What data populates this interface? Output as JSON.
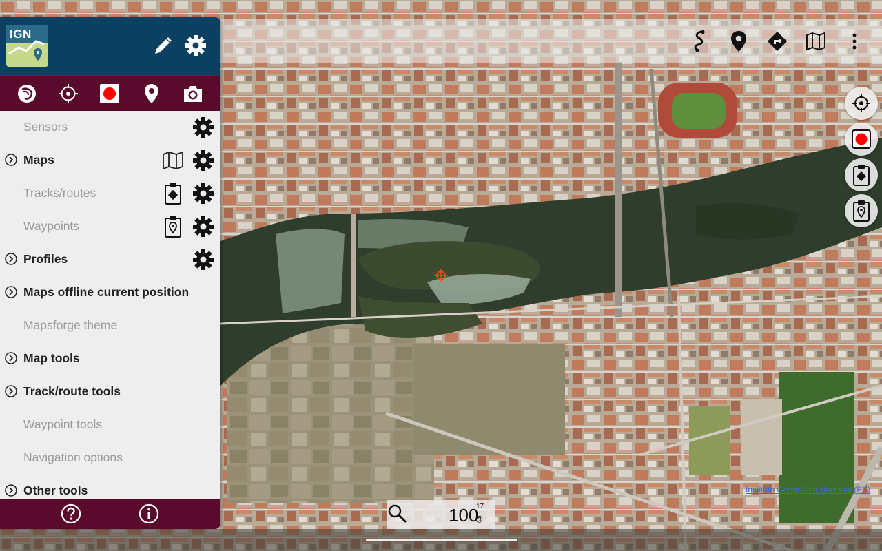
{
  "header": {
    "logo_text": "IGN",
    "edit_icon": "pencil-icon",
    "settings_icon": "gear-icon"
  },
  "toolbar": {
    "items": [
      {
        "icon": "route-icon"
      },
      {
        "icon": "location-pin-icon"
      },
      {
        "icon": "navigate-diamond-icon"
      },
      {
        "icon": "map-icon"
      },
      {
        "icon": "more-vert-icon"
      }
    ]
  },
  "quickbar": {
    "items": [
      {
        "icon": "compass-icon"
      },
      {
        "icon": "crosshair-icon"
      },
      {
        "icon": "record-icon"
      },
      {
        "icon": "waypoint-pin-icon"
      },
      {
        "icon": "camera-icon"
      }
    ]
  },
  "menu": {
    "items": [
      {
        "label": "Sensors"
      },
      {
        "label": "Maps"
      },
      {
        "label": "Tracks/routes"
      },
      {
        "label": "Waypoints"
      },
      {
        "label": "Profiles"
      },
      {
        "label": "Maps offline current position"
      },
      {
        "label": "Mapsforge theme"
      },
      {
        "label": "Map tools"
      },
      {
        "label": "Track/route tools"
      },
      {
        "label": "Waypoint tools"
      },
      {
        "label": "Navigation options"
      },
      {
        "label": "Other tools"
      }
    ]
  },
  "footer": {
    "help_icon": "help-icon",
    "info_icon": "info-icon"
  },
  "map": {
    "zoom_value": "100",
    "zoom_level": "17",
    "zoom_unit": "@",
    "attribution": "Instituto Geográfico Nacional (ES)"
  },
  "colors": {
    "header": "#0b4060",
    "accent_bar": "#5a0b2c",
    "panel_bg": "#eeeeee",
    "record": "#ff0000"
  }
}
